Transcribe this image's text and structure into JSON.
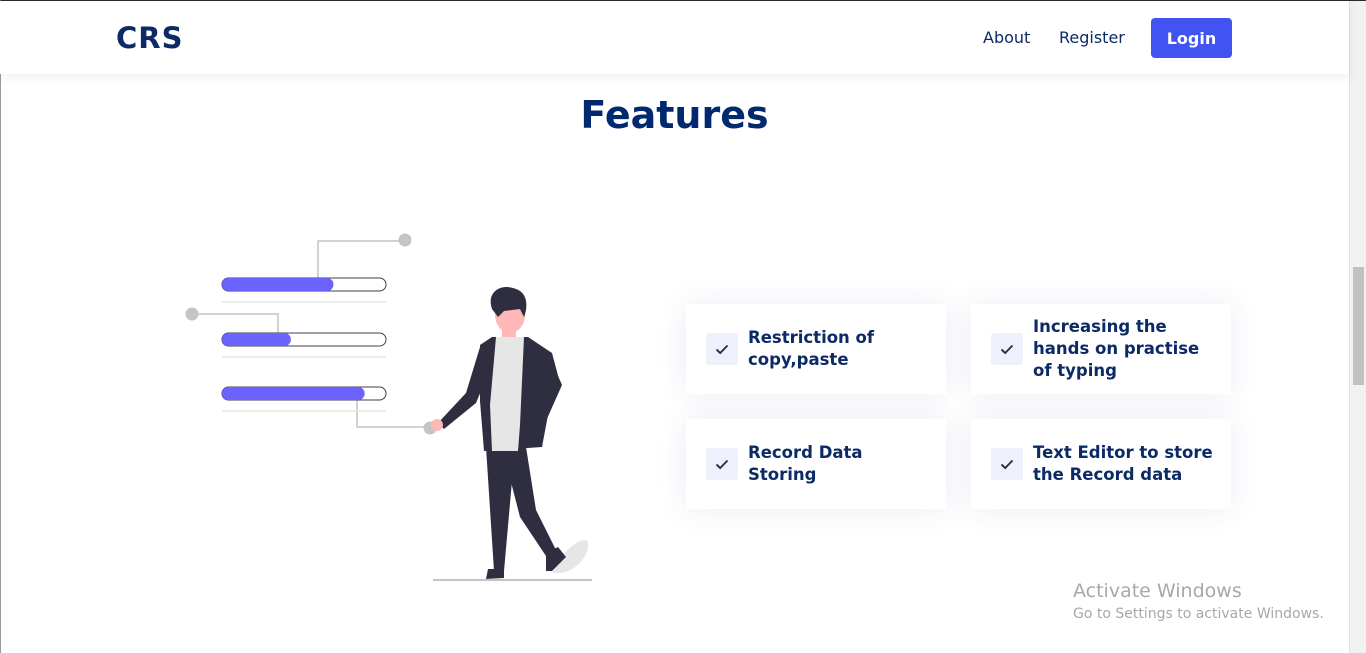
{
  "header": {
    "brand": "CRS",
    "nav": [
      {
        "label": "About"
      },
      {
        "label": "Register"
      }
    ],
    "login_label": "Login"
  },
  "features": {
    "title": "Features",
    "items": [
      {
        "label": "Restriction of copy,paste"
      },
      {
        "label": "Increasing the hands on practise of typing"
      },
      {
        "label": "Record Data Storing"
      },
      {
        "label": "Text Editor to store the Record data"
      }
    ]
  },
  "illustration": {
    "progress_bars": [
      0.68,
      0.42,
      0.87
    ]
  },
  "watermark": {
    "title": "Activate Windows",
    "subtitle": "Go to Settings to activate Windows."
  },
  "colors": {
    "accent": "#4154f1",
    "brand_text": "#0b2a66",
    "title_text": "#012970",
    "bar_fill": "#6c63ff",
    "figure_dark": "#2f2e41"
  },
  "icons": {
    "check": "check-icon"
  }
}
